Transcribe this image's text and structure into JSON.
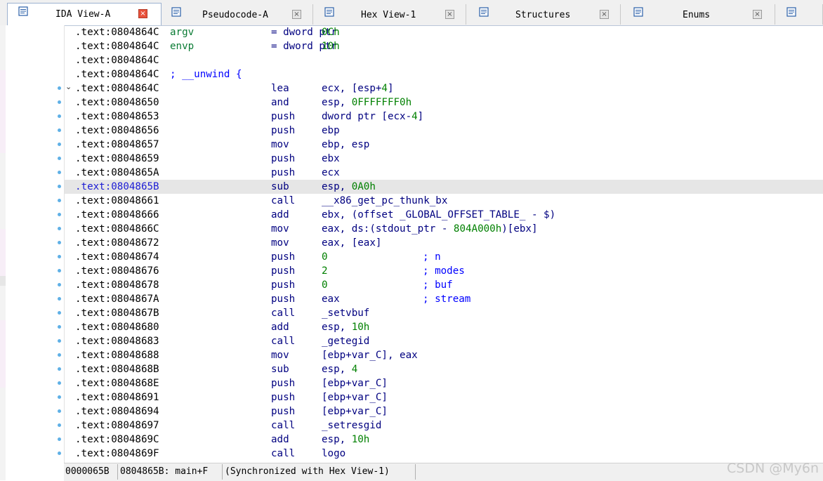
{
  "tabs": [
    {
      "label": "IDA View-A",
      "icon": "ida-view-icon",
      "active": true
    },
    {
      "label": "Pseudocode-A",
      "icon": "pseudocode-icon",
      "active": false
    },
    {
      "label": "Hex View-1",
      "icon": "hex-view-icon",
      "active": false
    },
    {
      "label": "Structures",
      "icon": "structures-icon",
      "active": false
    },
    {
      "label": "Enums",
      "icon": "enums-icon",
      "active": false
    },
    {
      "label": "",
      "icon": "imports-icon",
      "active": false
    }
  ],
  "disassembly": [
    {
      "addr": ".text:0804864C",
      "label": "argv",
      "mnem": "= dword ptr",
      "op": "0Ch"
    },
    {
      "addr": ".text:0804864C",
      "label": "envp",
      "mnem": "= dword ptr",
      "op": "10h"
    },
    {
      "addr": ".text:0804864C"
    },
    {
      "addr": ".text:0804864C",
      "labelc": "; __unwind {"
    },
    {
      "addr": ".text:0804864C",
      "mnem": "lea",
      "op": "ecx, [esp+4]",
      "dot": true,
      "chev": true
    },
    {
      "addr": ".text:08048650",
      "mnem": "and",
      "op": "esp, 0FFFFFFF0h",
      "dot": true
    },
    {
      "addr": ".text:08048653",
      "mnem": "push",
      "op": "dword ptr [ecx-4]",
      "dot": true
    },
    {
      "addr": ".text:08048656",
      "mnem": "push",
      "op": "ebp",
      "dot": true
    },
    {
      "addr": ".text:08048657",
      "mnem": "mov",
      "op": "ebp, esp",
      "dot": true
    },
    {
      "addr": ".text:08048659",
      "mnem": "push",
      "op": "ebx",
      "dot": true
    },
    {
      "addr": ".text:0804865A",
      "mnem": "push",
      "op": "ecx",
      "dot": true
    },
    {
      "addr": ".text:0804865B",
      "mnem": "sub",
      "op": "esp, 0A0h",
      "dot": true,
      "highlight": true
    },
    {
      "addr": ".text:08048661",
      "mnem": "call",
      "op": "__x86_get_pc_thunk_bx",
      "dot": true
    },
    {
      "addr": ".text:08048666",
      "mnem": "add",
      "op": "ebx, (offset _GLOBAL_OFFSET_TABLE_ - $)",
      "dot": true
    },
    {
      "addr": ".text:0804866C",
      "mnem": "mov",
      "op": "eax, ds:(stdout_ptr - 804A000h)[ebx]",
      "dot": true
    },
    {
      "addr": ".text:08048672",
      "mnem": "mov",
      "op": "eax, [eax]",
      "dot": true
    },
    {
      "addr": ".text:08048674",
      "mnem": "push",
      "op": "0",
      "cmt": "; n",
      "dot": true
    },
    {
      "addr": ".text:08048676",
      "mnem": "push",
      "op": "2",
      "cmt": "; modes",
      "dot": true
    },
    {
      "addr": ".text:08048678",
      "mnem": "push",
      "op": "0",
      "cmt": "; buf",
      "dot": true
    },
    {
      "addr": ".text:0804867A",
      "mnem": "push",
      "op": "eax",
      "cmt": "; stream",
      "dot": true
    },
    {
      "addr": ".text:0804867B",
      "mnem": "call",
      "op": "_setvbuf",
      "dot": true
    },
    {
      "addr": ".text:08048680",
      "mnem": "add",
      "op": "esp, 10h",
      "dot": true
    },
    {
      "addr": ".text:08048683",
      "mnem": "call",
      "op": "_getegid",
      "dot": true
    },
    {
      "addr": ".text:08048688",
      "mnem": "mov",
      "op": "[ebp+var_C], eax",
      "dot": true
    },
    {
      "addr": ".text:0804868B",
      "mnem": "sub",
      "op": "esp, 4",
      "dot": true
    },
    {
      "addr": ".text:0804868E",
      "mnem": "push",
      "op": "[ebp+var_C]",
      "dot": true
    },
    {
      "addr": ".text:08048691",
      "mnem": "push",
      "op": "[ebp+var_C]",
      "dot": true
    },
    {
      "addr": ".text:08048694",
      "mnem": "push",
      "op": "[ebp+var_C]",
      "dot": true
    },
    {
      "addr": ".text:08048697",
      "mnem": "call",
      "op": "_setresgid",
      "dot": true
    },
    {
      "addr": ".text:0804869C",
      "mnem": "add",
      "op": "esp, 10h",
      "dot": true
    },
    {
      "addr": ".text:0804869F",
      "mnem": "call",
      "op": "logo",
      "dot": true
    }
  ],
  "status": {
    "offset": "0000065B",
    "location": "0804865B: main+F",
    "sync": "(Synchronized with Hex View-1)"
  },
  "watermark": "CSDN @My6n",
  "colors": {
    "address": "#000000",
    "instruction": "#000080",
    "comment": "#0000ff",
    "number": "#008000",
    "highlight_row": "#e6e6e6",
    "breakpoint_dot": "#5fb0e6",
    "active_tab_close": "#e8503a"
  }
}
